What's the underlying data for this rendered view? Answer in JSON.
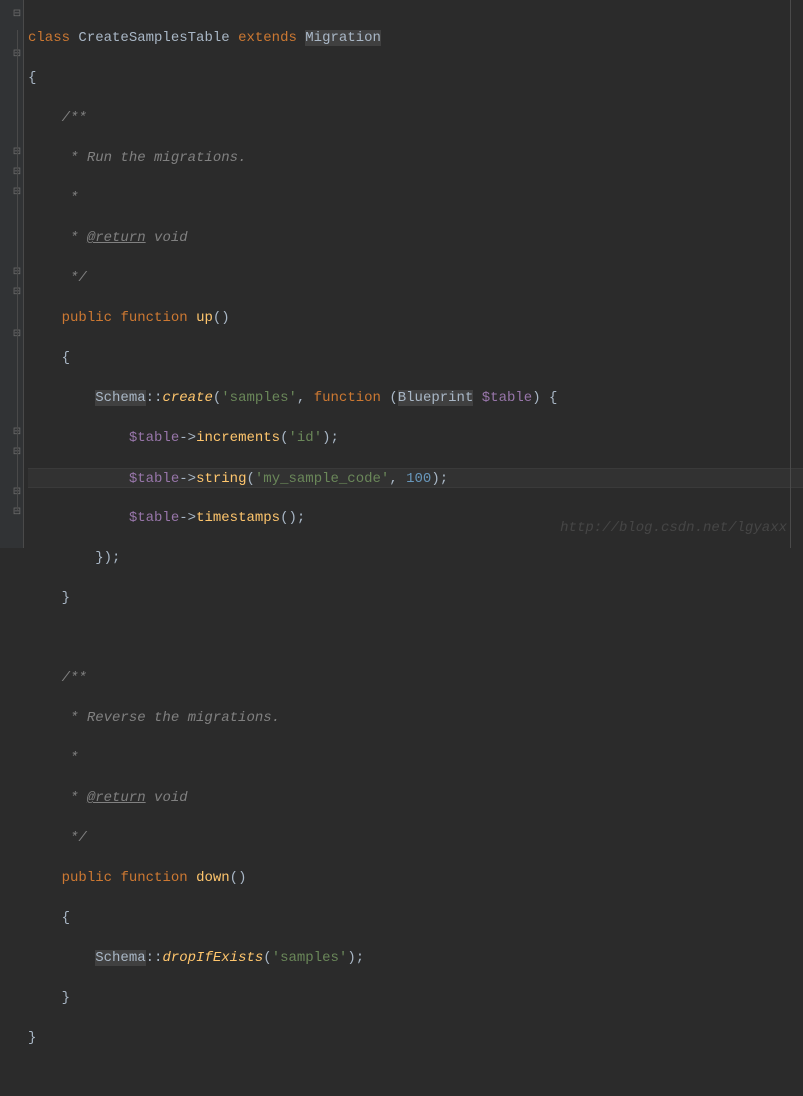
{
  "code": {
    "l1_class": "class",
    "l1_name": "CreateSamplesTable",
    "l1_extends": "extends",
    "l1_migration": "Migration",
    "l2_brace": "{",
    "doc1_l1": "/**",
    "doc1_l2": " * Run the migrations.",
    "doc1_l3": " *",
    "doc1_l4a": " * ",
    "doc1_l4_tag": "@return",
    "doc1_l4b": " void",
    "doc1_l5": " */",
    "up_public": "public",
    "up_function": "function",
    "up_name": "up",
    "up_parens": "()",
    "up_brace_open": "{",
    "schema1": "Schema",
    "schema_dbl": "::",
    "create": "create",
    "create_open": "(",
    "create_str": "'samples'",
    "create_comma": ", ",
    "create_fn": "function",
    "create_sp": " (",
    "blueprint": "Blueprint",
    "sp2": " ",
    "table_param": "$table",
    "create_close": ") {",
    "inc_table": "$table",
    "inc_arrow": "->",
    "inc_fn": "increments",
    "inc_open": "(",
    "inc_str": "'id'",
    "inc_close": ");",
    "str_table": "$table",
    "str_arrow": "->",
    "str_fn": "string",
    "str_open": "(",
    "str_str": "'my_sample_code'",
    "str_comma": ", ",
    "str_num": "100",
    "str_close": ");",
    "ts_table": "$table",
    "ts_arrow": "->",
    "ts_fn": "timestamps",
    "ts_parens": "();",
    "closure_close": "});",
    "up_brace_close": "}",
    "doc2_l1": "/**",
    "doc2_l2": " * Reverse the migrations.",
    "doc2_l3": " *",
    "doc2_l4a": " * ",
    "doc2_l4_tag": "@return",
    "doc2_l4b": " void",
    "doc2_l5": " */",
    "down_public": "public",
    "down_function": "function",
    "down_name": "down",
    "down_parens": "()",
    "down_brace_open": "{",
    "schema2": "Schema",
    "schema2_dbl": "::",
    "drop": "dropIfExists",
    "drop_open": "(",
    "drop_str": "'samples'",
    "drop_close": ");",
    "down_brace_close": "}",
    "class_close": "}"
  },
  "watermark": "http://blog.csdn.net/lgyaxx"
}
